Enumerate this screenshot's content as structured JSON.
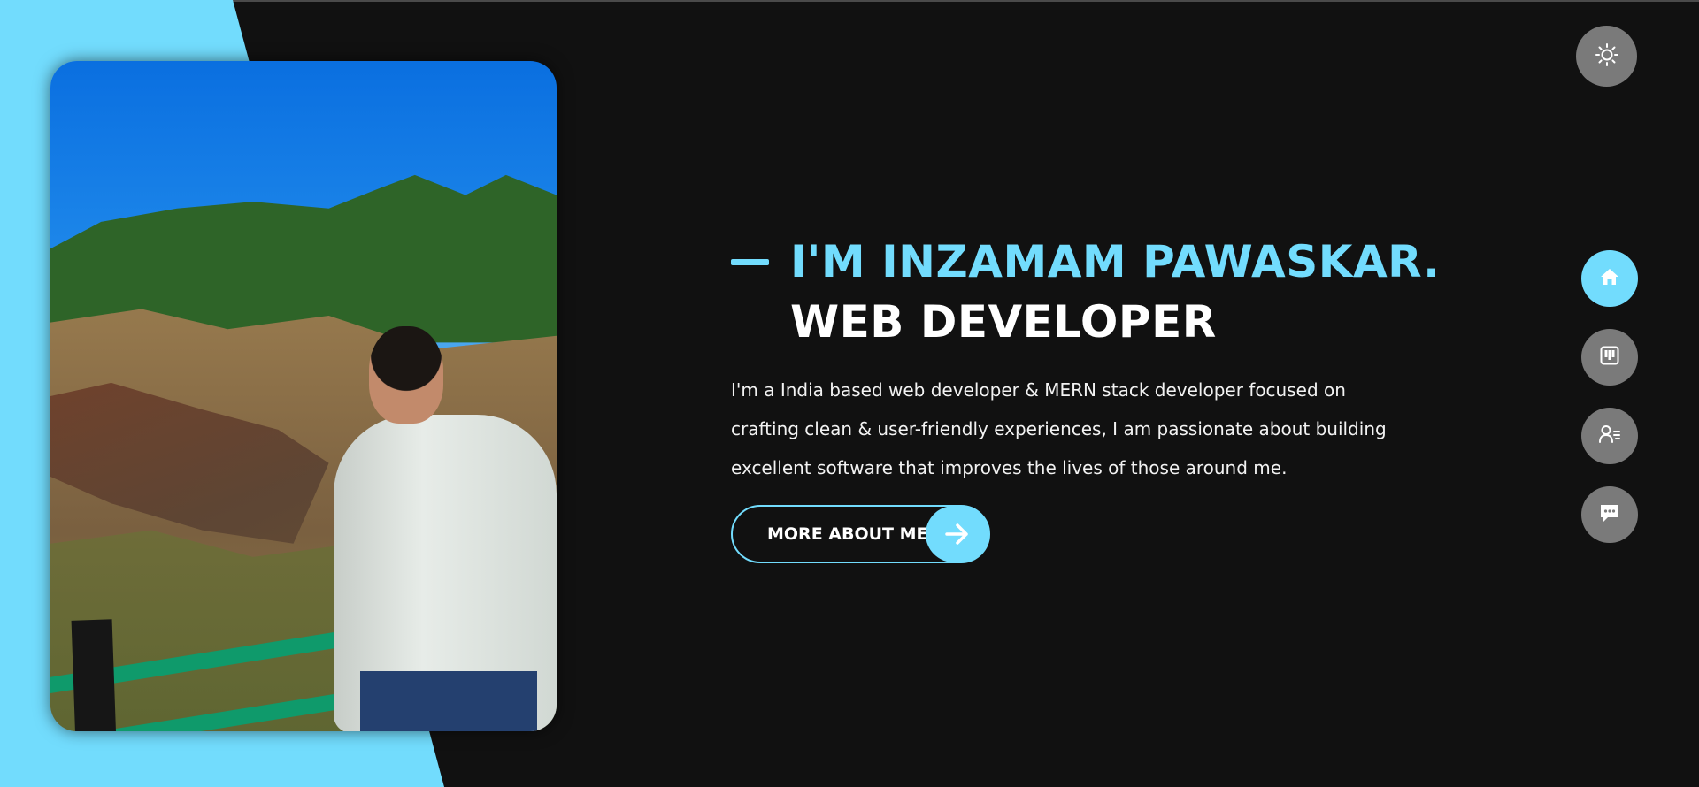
{
  "theme": {
    "background": "#111111",
    "accent": "#72dcfd",
    "control_gray": "#7a7a7a"
  },
  "hero": {
    "name_line": "I'M INZAMAM PAWASKAR.",
    "role_line": "WEB DEVELOPER",
    "description": "I'm a India based web developer & MERN stack developer focused on crafting clean & user-friendly experiences, I am passionate about building excellent software that improves the lives of those around me.",
    "cta_label": "MORE ABOUT ME",
    "cta_icon": "arrow-right-icon"
  },
  "controls": {
    "theme_toggle_icon": "sun-icon"
  },
  "nav": {
    "items": [
      {
        "icon": "home-icon",
        "active": true
      },
      {
        "icon": "portfolio-icon",
        "active": false
      },
      {
        "icon": "user-details-icon",
        "active": false
      },
      {
        "icon": "chat-icon",
        "active": false
      }
    ]
  },
  "photo": {
    "subject": "portrait-photo"
  }
}
